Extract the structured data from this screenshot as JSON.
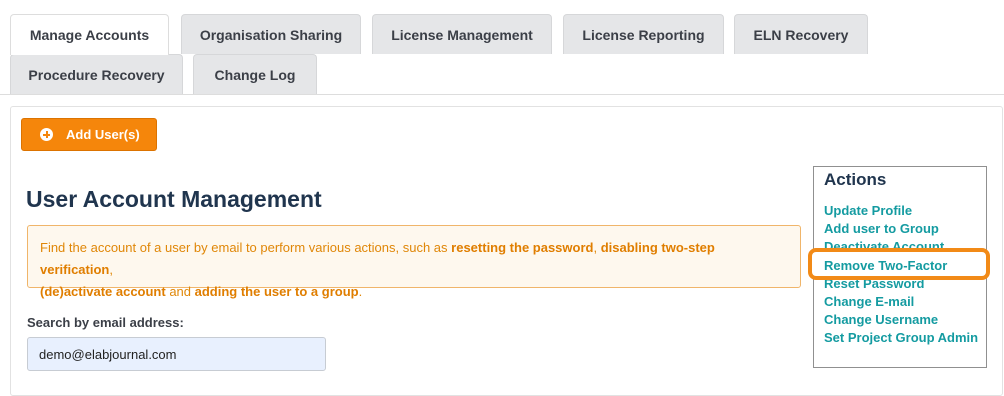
{
  "tabs": {
    "manage_accounts": "Manage Accounts",
    "organisation_sharing": "Organisation Sharing",
    "license_management": "License Management",
    "license_reporting": "License Reporting",
    "eln_recovery": "ELN Recovery",
    "procedure_recovery": "Procedure Recovery",
    "change_log": "Change Log"
  },
  "add_users": {
    "label": "Add User(s)",
    "icon": "plus-circle-icon"
  },
  "main": {
    "title": "User Account Management",
    "info": {
      "part1": "Find the account of a user by email to perform various actions, such as ",
      "bold1": "resetting the password",
      "sep1": ", ",
      "bold2": "disabling two-step verification",
      "sep2": ", ",
      "bold3": "(de)activate account",
      "sep3": " and ",
      "bold4": "adding the user to a group",
      "end": "."
    },
    "search": {
      "label": "Search by email address:",
      "value": "demo@elabjournal.com"
    }
  },
  "actions": {
    "title": "Actions",
    "update_profile": "Update Profile",
    "add_to_group": "Add user to Group",
    "deactivate": "Deactivate Account",
    "remove_two_factor": "Remove Two-Factor",
    "reset_password": "Reset Password",
    "change_email": "Change E-mail",
    "change_username": "Change Username",
    "set_project_group_admin": "Set Project Group Admin"
  },
  "colors": {
    "accent": "#f5860b",
    "link": "#149ba1",
    "heading": "#20354e",
    "highlight": "#f28a17"
  }
}
